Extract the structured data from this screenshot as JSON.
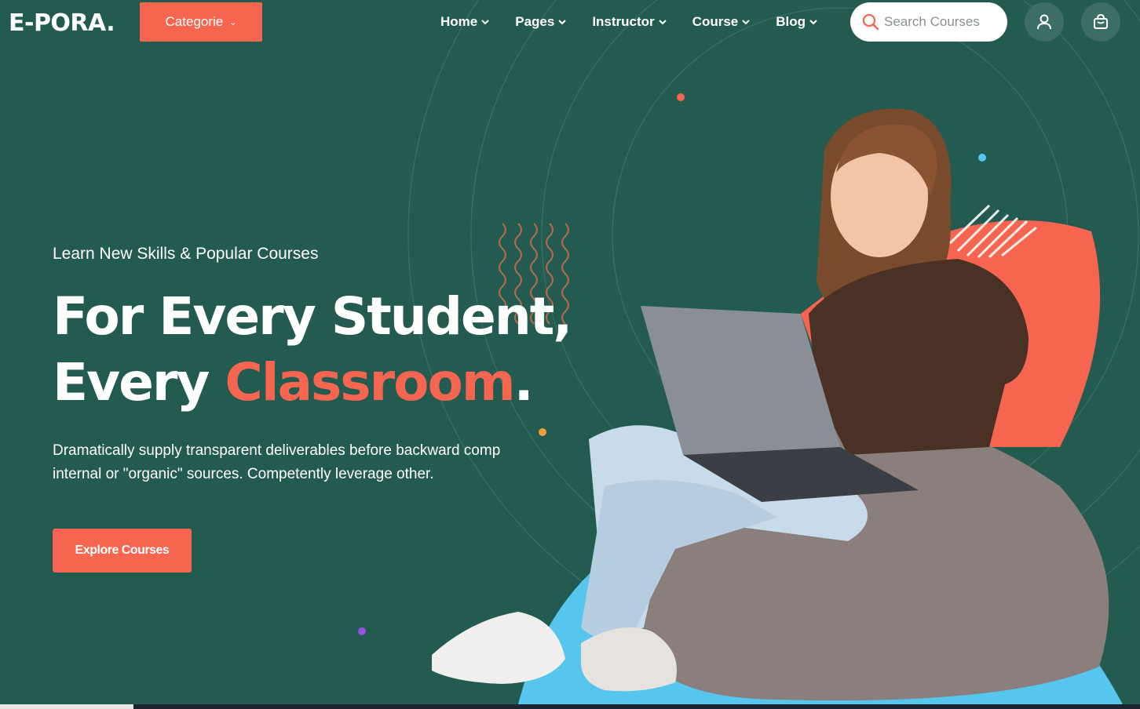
{
  "header": {
    "logo": "E-PORA.",
    "category_button": "Categorie",
    "nav": [
      {
        "label": "Home"
      },
      {
        "label": "Pages"
      },
      {
        "label": "Instructor"
      },
      {
        "label": "Course"
      },
      {
        "label": "Blog"
      }
    ],
    "search": {
      "placeholder": "Search Courses",
      "value": ""
    }
  },
  "hero": {
    "subtitle": "Learn New Skills & Popular Courses",
    "title_line1": "For Every Student,",
    "title_line2_plain": "Every ",
    "title_line2_accent": "Classroom",
    "title_line2_end": ".",
    "description": "Dramatically supply transparent deliverables before backward comp internal or \"organic\" sources. Competently leverage other.",
    "cta": "Explore Courses"
  },
  "colors": {
    "background": "#245b51",
    "accent": "#f66550",
    "secondary": "#56c6ee"
  },
  "icons": [
    "chevron-down-icon",
    "search-icon",
    "user-icon",
    "cart-icon"
  ]
}
